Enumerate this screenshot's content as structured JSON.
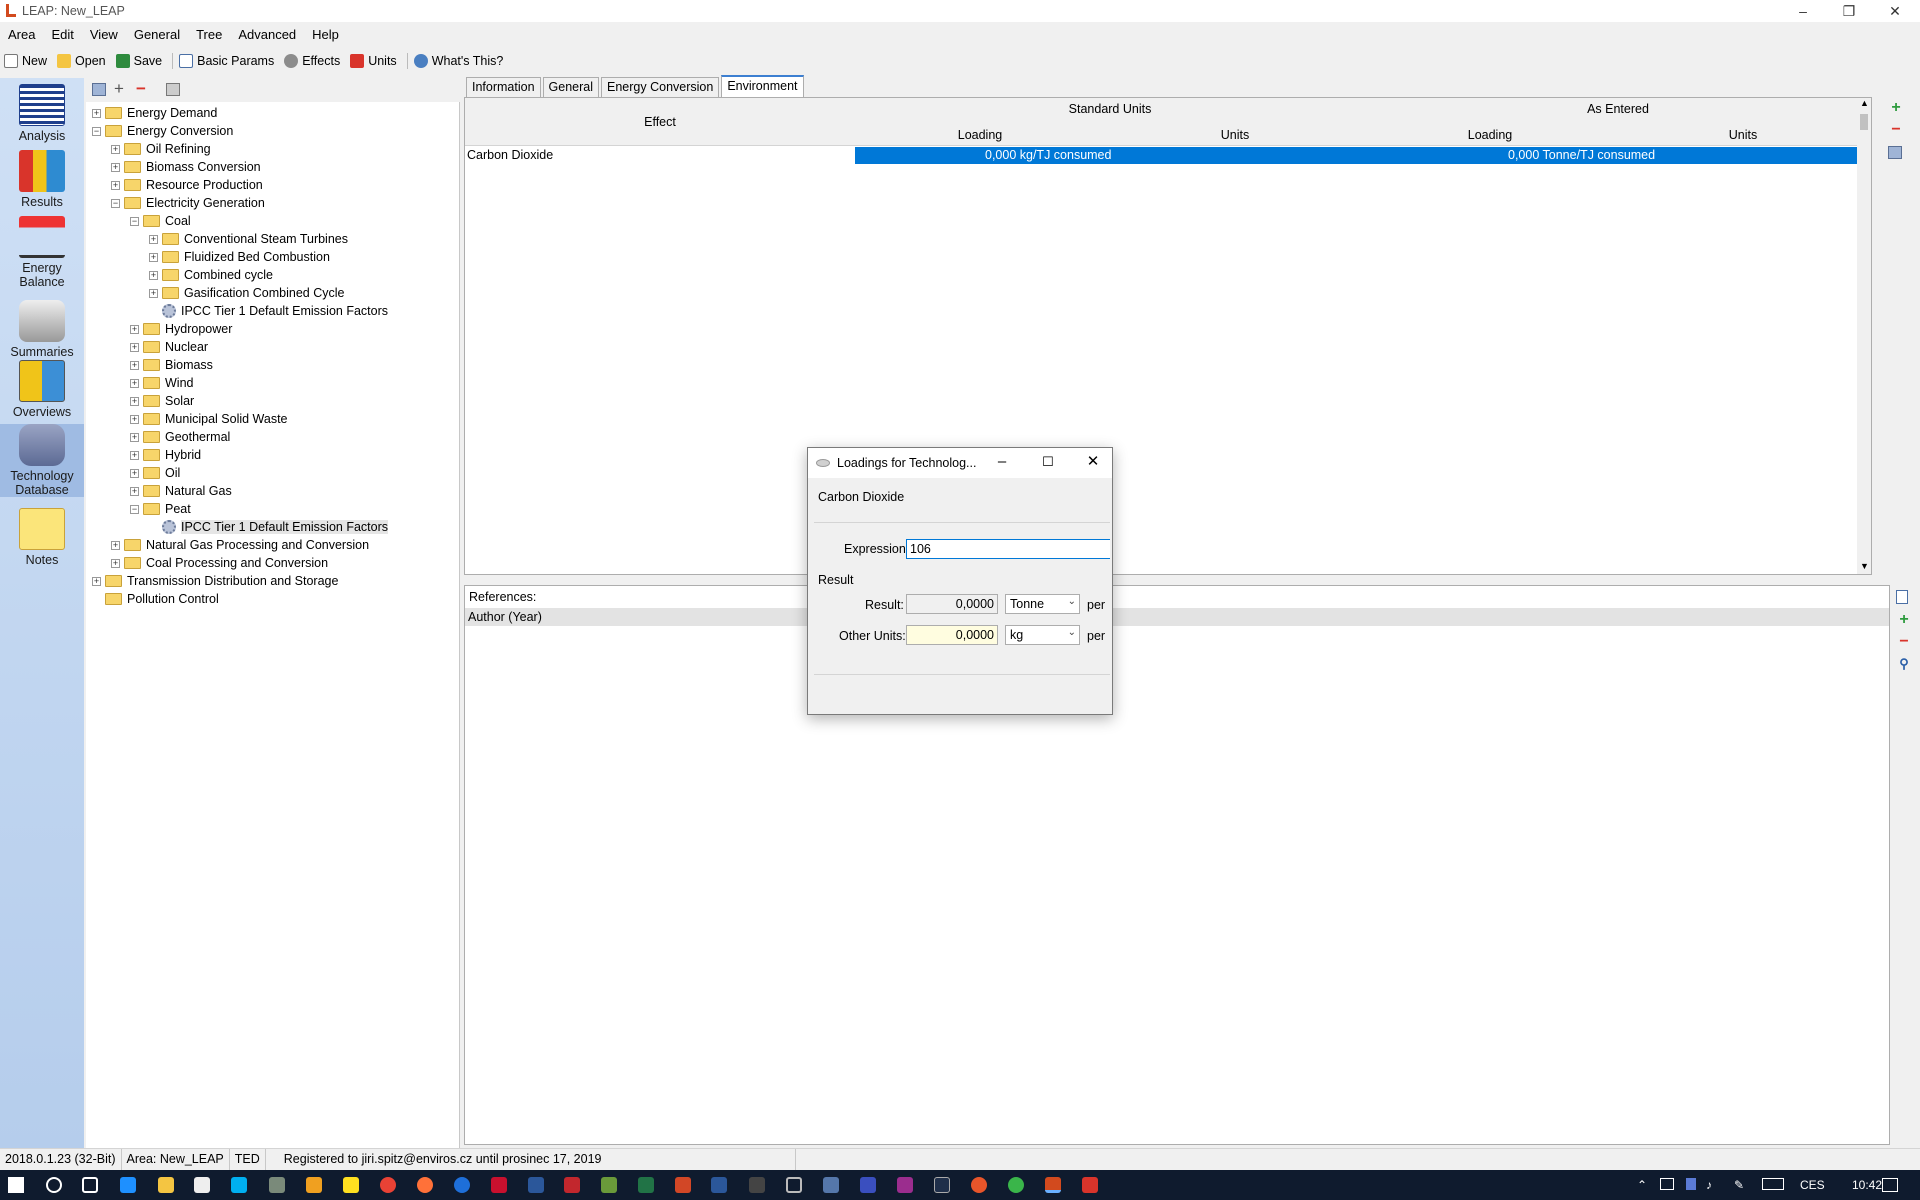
{
  "window": {
    "title": "LEAP: New_LEAP"
  },
  "menu": [
    "Area",
    "Edit",
    "View",
    "General",
    "Tree",
    "Advanced",
    "Help"
  ],
  "toolbar": {
    "new": "New",
    "open": "Open",
    "save": "Save",
    "basic_params": "Basic Params",
    "effects": "Effects",
    "units": "Units",
    "whats_this": "What's This?"
  },
  "nav": {
    "analysis": "Analysis",
    "results": "Results",
    "energy_balance": "Energy Balance",
    "summaries": "Summaries",
    "overviews": "Overviews",
    "technology_database": "Technology Database",
    "notes": "Notes"
  },
  "tree": [
    {
      "label": "Energy Demand",
      "exp": "+"
    },
    {
      "label": "Energy Conversion",
      "exp": "−"
    },
    {
      "label": "Oil Refining",
      "exp": "+"
    },
    {
      "label": "Biomass Conversion",
      "exp": "+"
    },
    {
      "label": "Resource Production",
      "exp": "+"
    },
    {
      "label": "Electricity Generation",
      "exp": "−"
    },
    {
      "label": "Coal",
      "exp": "−"
    },
    {
      "label": "Conventional Steam Turbines",
      "exp": "+"
    },
    {
      "label": "Fluidized Bed Combustion",
      "exp": "+"
    },
    {
      "label": "Combined cycle",
      "exp": "+"
    },
    {
      "label": "Gasification Combined Cycle",
      "exp": "+"
    },
    {
      "label": "IPCC Tier 1 Default Emission Factors",
      "exp": ""
    },
    {
      "label": "Hydropower",
      "exp": "+"
    },
    {
      "label": "Nuclear",
      "exp": "+"
    },
    {
      "label": "Biomass",
      "exp": "+"
    },
    {
      "label": "Wind",
      "exp": "+"
    },
    {
      "label": "Solar",
      "exp": "+"
    },
    {
      "label": "Municipal Solid Waste",
      "exp": "+"
    },
    {
      "label": "Geothermal",
      "exp": "+"
    },
    {
      "label": "Hybrid",
      "exp": "+"
    },
    {
      "label": "Oil",
      "exp": "+"
    },
    {
      "label": "Natural Gas",
      "exp": "+"
    },
    {
      "label": "Peat",
      "exp": "−"
    },
    {
      "label": "IPCC Tier 1 Default Emission Factors",
      "exp": ""
    },
    {
      "label": "Natural Gas Processing and Conversion",
      "exp": "+"
    },
    {
      "label": "Coal Processing and Conversion",
      "exp": "+"
    },
    {
      "label": "Transmission Distribution and Storage",
      "exp": "+"
    },
    {
      "label": "Pollution Control",
      "exp": ""
    }
  ],
  "tabs": [
    "Information",
    "General",
    "Energy Conversion",
    "Environment"
  ],
  "grid": {
    "effect_header": "Effect",
    "standard_units": "Standard Units",
    "as_entered": "As Entered",
    "loading": "Loading",
    "units": "Units",
    "row": {
      "effect": "Carbon Dioxide",
      "std_value": "0,000 kg/TJ consumed",
      "entered_value": "0,000 Tonne/TJ consumed"
    }
  },
  "references": {
    "label": "References:",
    "column": "Author (Year)"
  },
  "dialog": {
    "title": "Loadings for Technolog...",
    "subtitle": "Carbon Dioxide",
    "expression_label": "Expression:",
    "expression_value": "106",
    "result_group": "Result",
    "result_label": "Result:",
    "result_value": "0,0000",
    "result_unit": "Tonne",
    "per": "per",
    "other_units_label": "Other Units:",
    "other_value": "0,0000",
    "other_unit": "kg"
  },
  "status": {
    "version": "2018.0.1.23 (32-Bit)",
    "area": "Area: New_LEAP",
    "ted": "TED",
    "registered": "Registered to jiri.spitz@enviros.cz until prosinec 17, 2019"
  },
  "taskbar": {
    "lang": "CES",
    "time": "10:42"
  }
}
